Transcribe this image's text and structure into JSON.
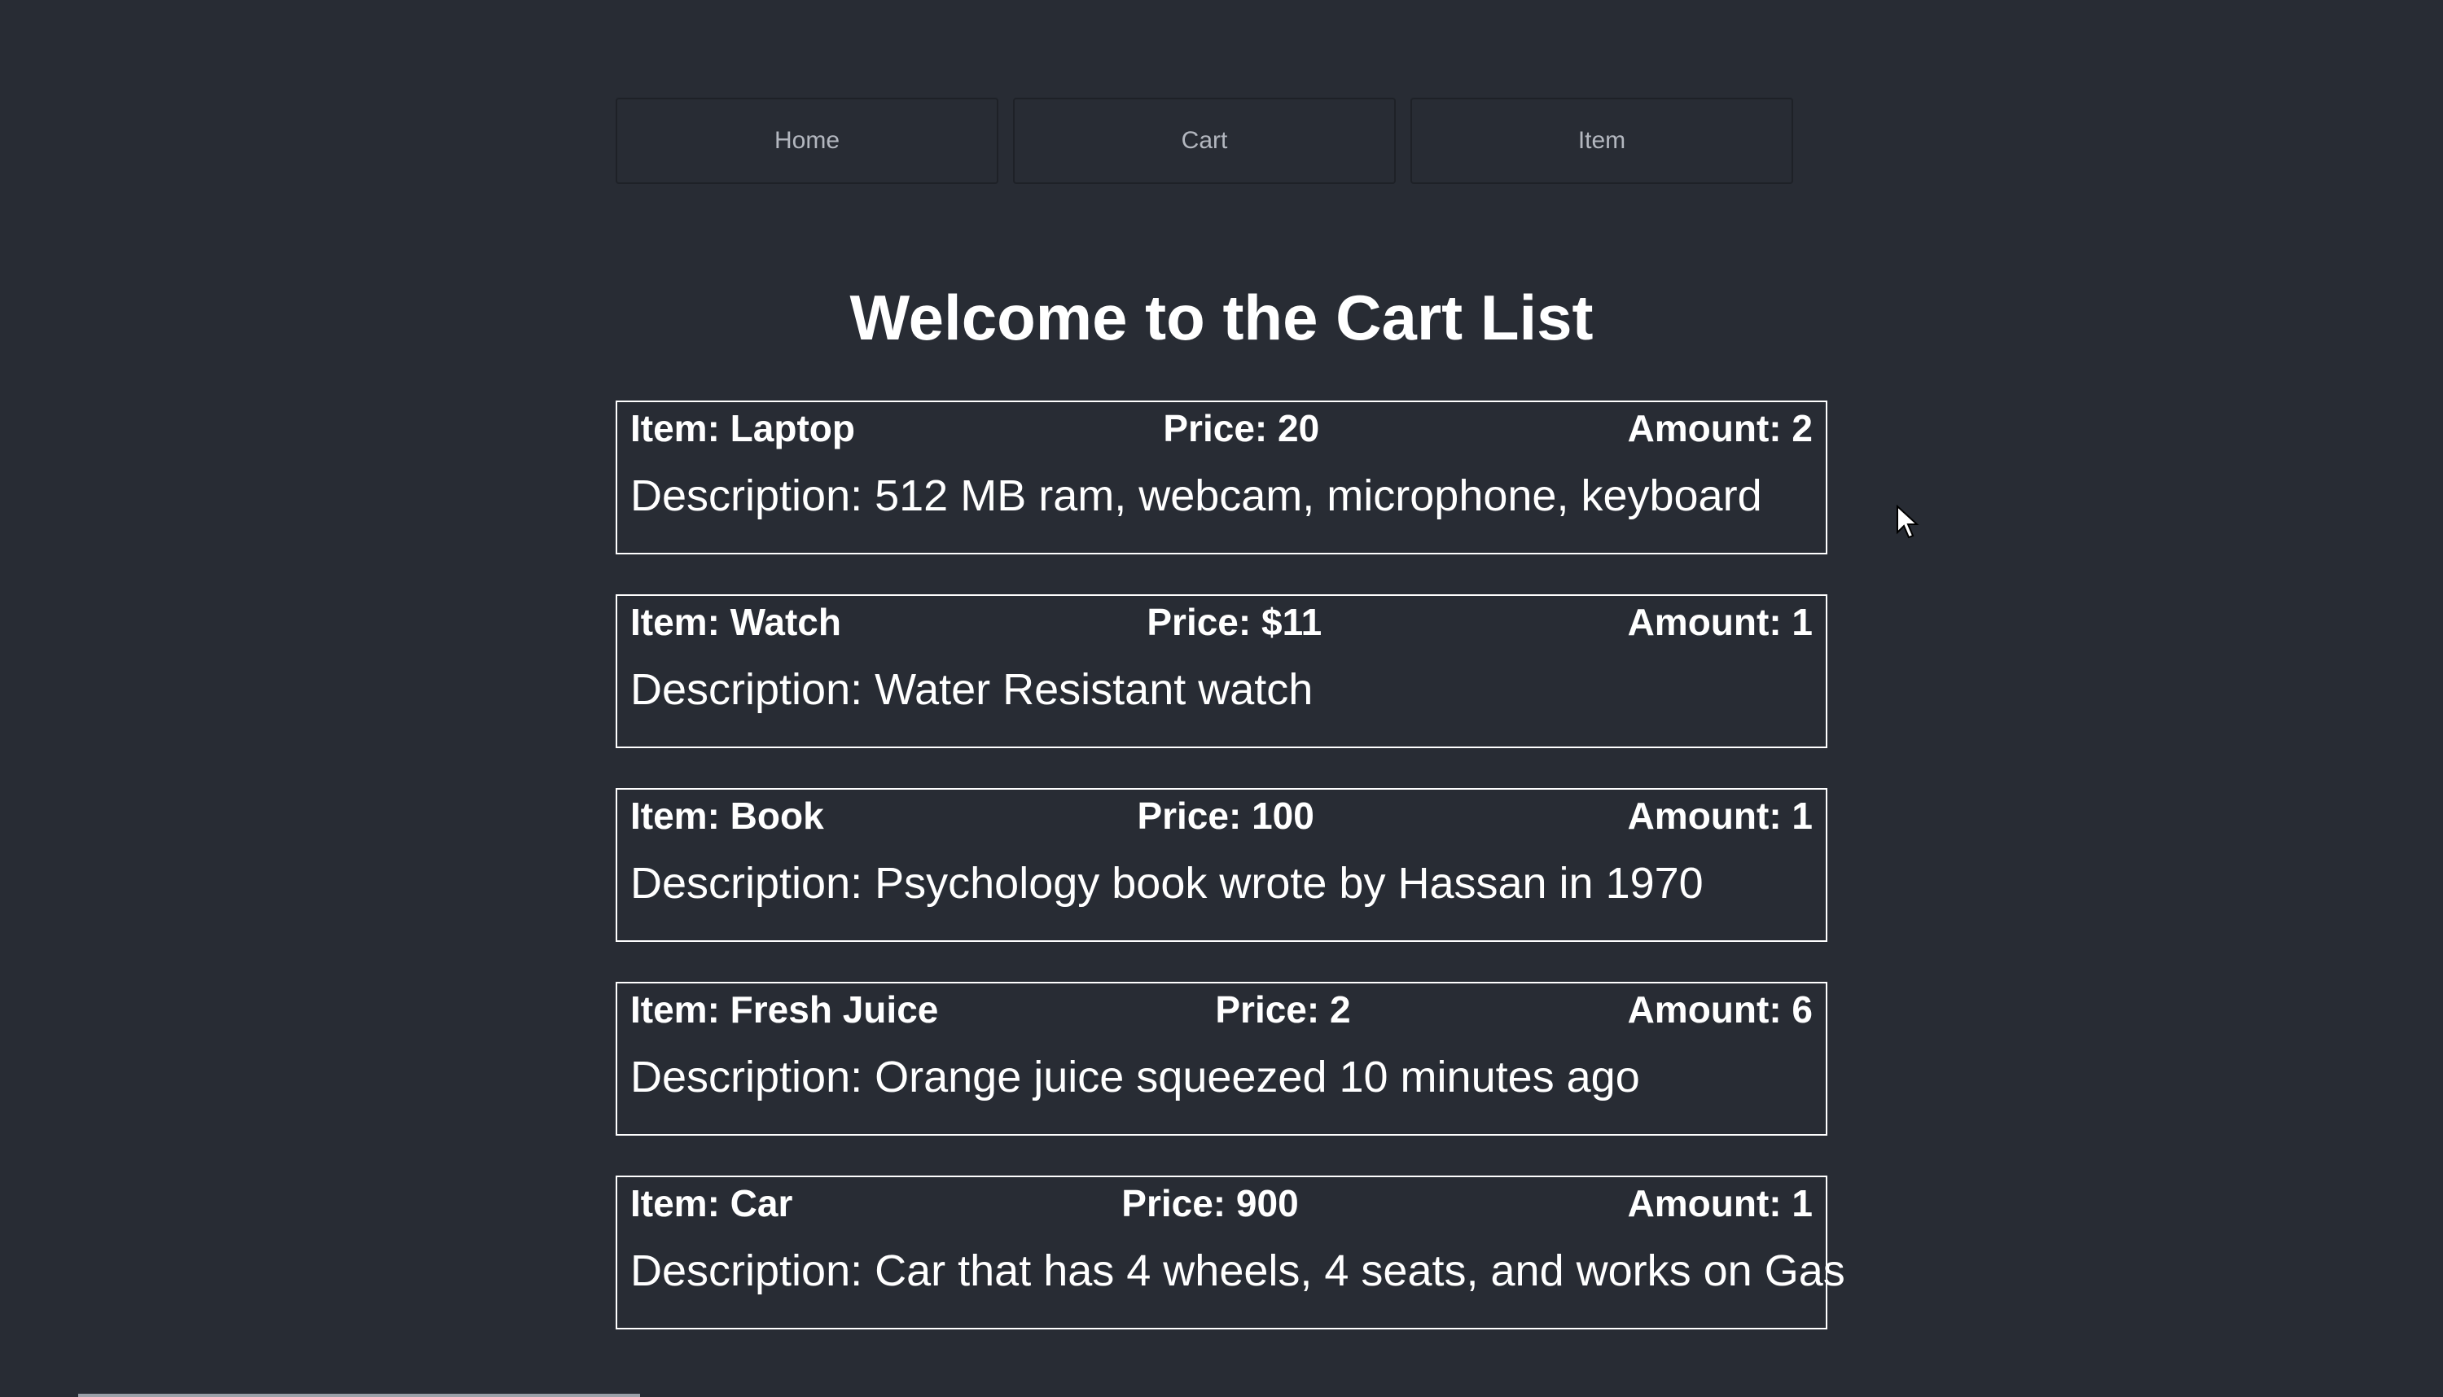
{
  "nav": {
    "home_label": "Home",
    "cart_label": "Cart",
    "item_label": "Item"
  },
  "page": {
    "title": "Welcome to the Cart List"
  },
  "cart": [
    {
      "item": "Item: Laptop",
      "price": "Price: 20",
      "amount": "Amount: 2",
      "description": "Description: 512 MB ram, webcam, microphone, keyboard"
    },
    {
      "item": "Item: Watch",
      "price": "Price: $11",
      "amount": "Amount: 1",
      "description": "Description: Water Resistant watch"
    },
    {
      "item": "Item: Book",
      "price": "Price: 100",
      "amount": "Amount: 1",
      "description": "Description: Psychology book wrote by Hassan in 1970"
    },
    {
      "item": "Item: Fresh Juice",
      "price": "Price: 2",
      "amount": "Amount: 6",
      "description": "Description: Orange juice squeezed 10 minutes ago"
    },
    {
      "item": "Item: Car",
      "price": "Price: 900",
      "amount": "Amount: 1",
      "description": "Description: Car that has 4 wheels, 4 seats, and works on Gas"
    }
  ],
  "colors": {
    "background": "#282c34",
    "text": "#ffffff",
    "nav_text": "#b3b7bf"
  }
}
